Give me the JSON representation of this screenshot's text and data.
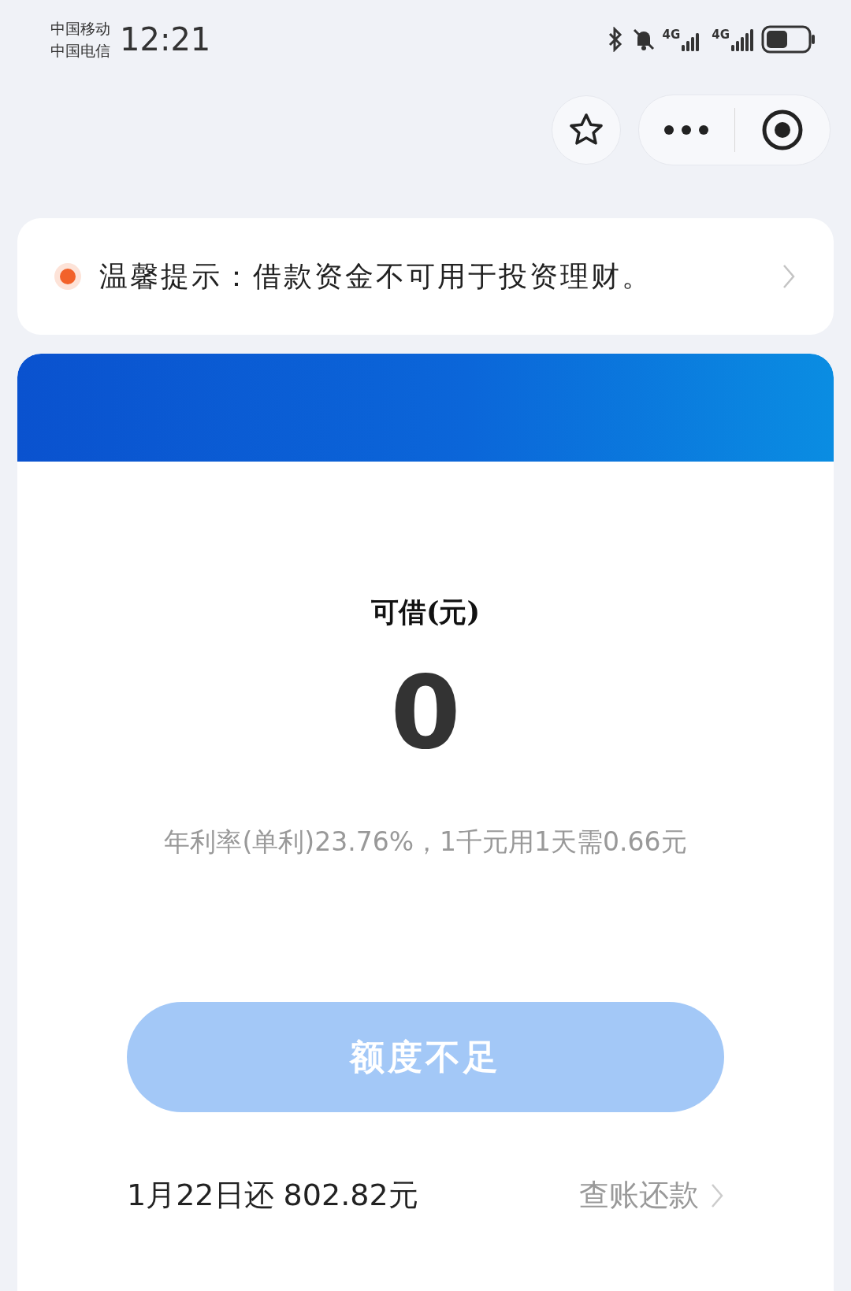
{
  "status_bar": {
    "carriers": [
      "中国移动",
      "中国电信"
    ],
    "time": "12:21",
    "network_1": "4G",
    "network_2": "4G"
  },
  "notice": {
    "text": "温馨提示：借款资金不可用于投资理财。"
  },
  "loan_card": {
    "label": "可借(元)",
    "amount": "0",
    "rate": "年利率(单利)23.76%，1千元用1天需0.66元",
    "button": {
      "label": "额度不足",
      "disabled": true
    },
    "due": "1月22日还 802.82元",
    "link": "查账还款"
  }
}
